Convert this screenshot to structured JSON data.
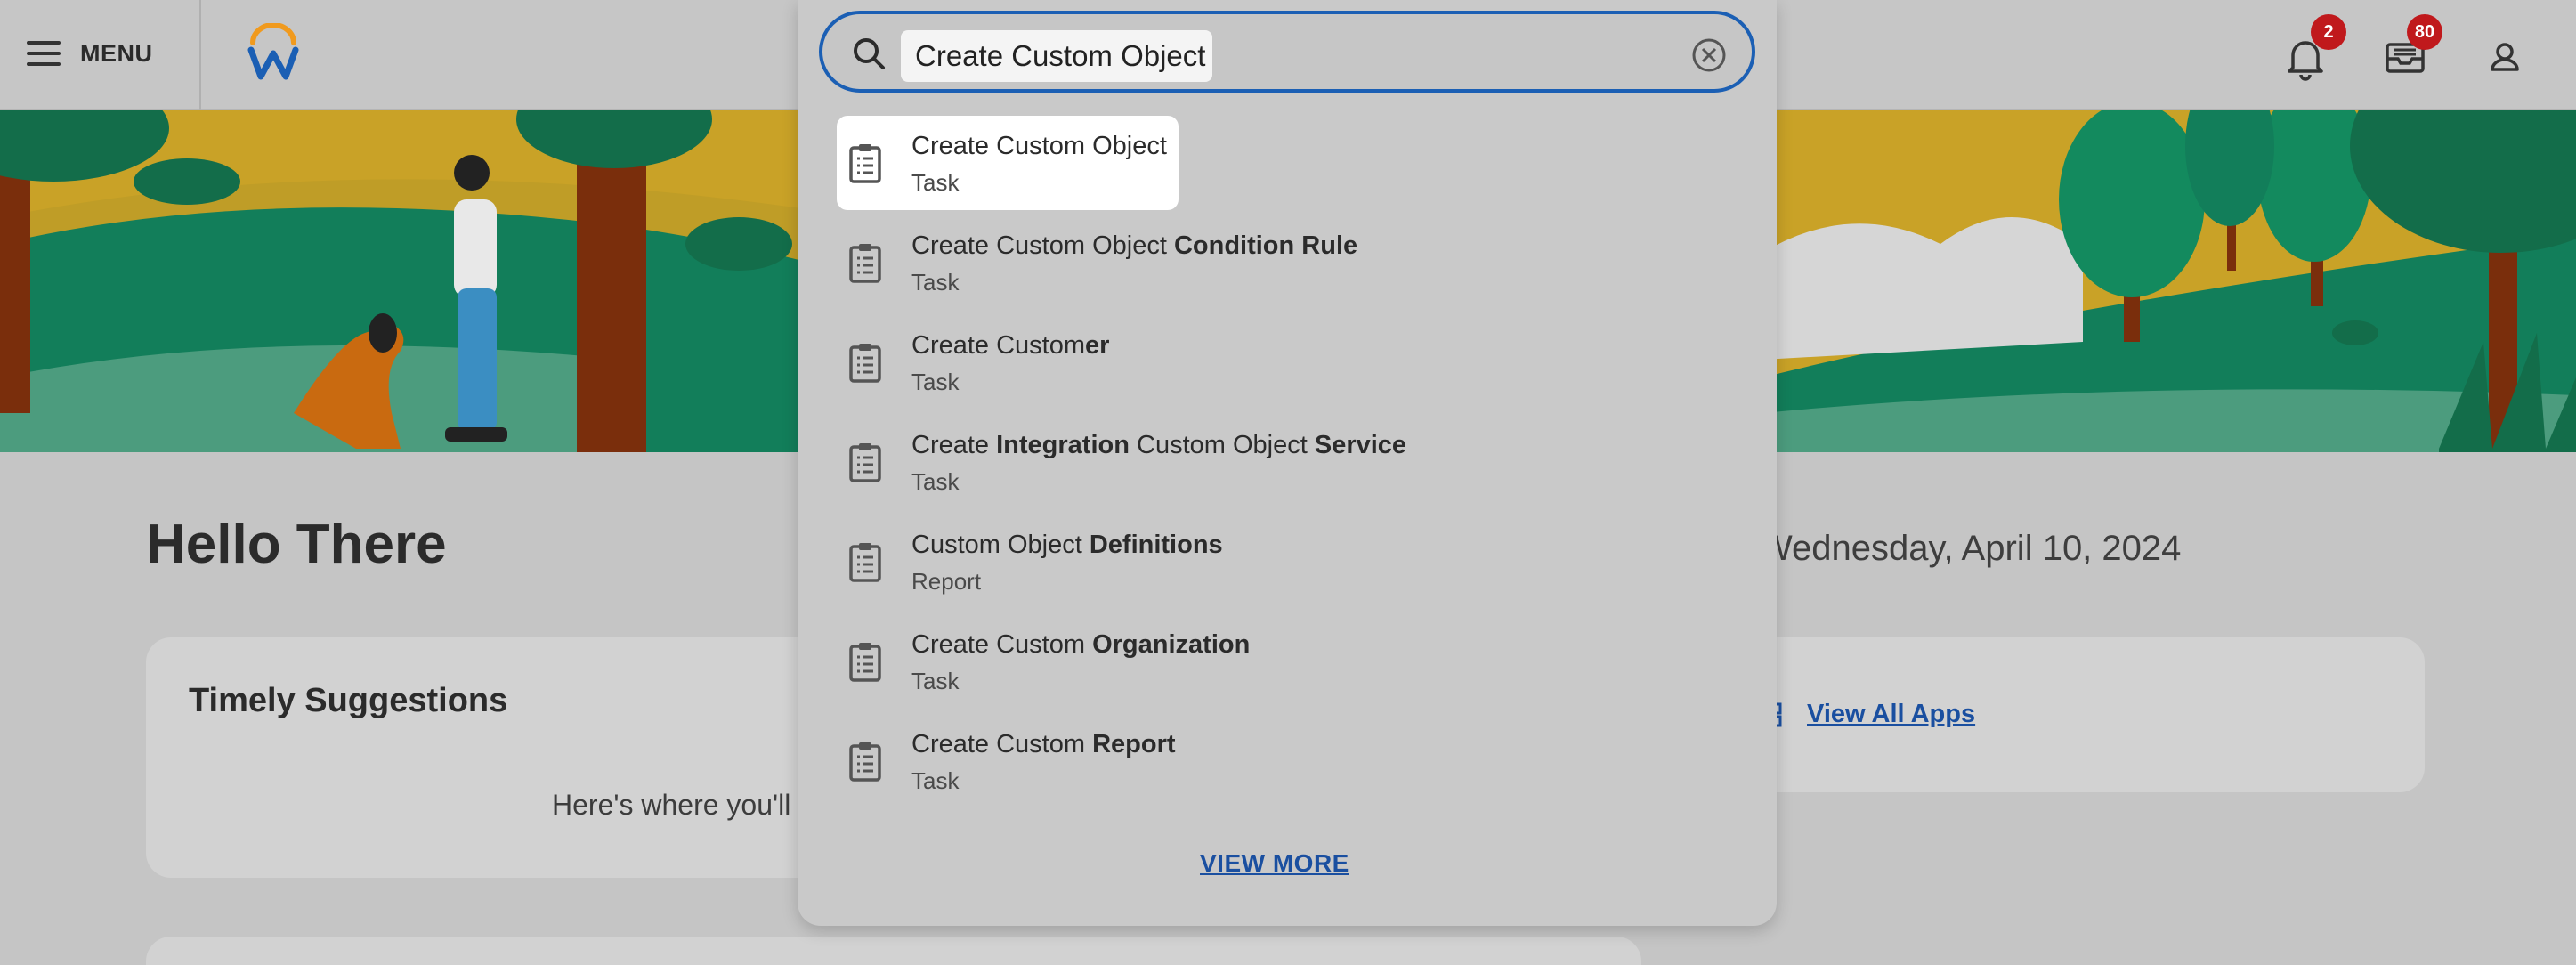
{
  "header": {
    "menu_label": "MENU",
    "notifications_count": "2",
    "inbox_count": "80"
  },
  "search": {
    "value": "Create Custom Object",
    "results": [
      {
        "parts": [
          {
            "t": "Create Custom Object",
            "b": false
          }
        ],
        "type": "Task"
      },
      {
        "parts": [
          {
            "t": "Create Custom Object ",
            "b": false
          },
          {
            "t": "Condition Rule",
            "b": true
          }
        ],
        "type": "Task"
      },
      {
        "parts": [
          {
            "t": "Create Custom",
            "b": false
          },
          {
            "t": "er",
            "b": true
          }
        ],
        "type": "Task"
      },
      {
        "parts": [
          {
            "t": "Create ",
            "b": false
          },
          {
            "t": "Integration",
            "b": true
          },
          {
            "t": " Custom Object ",
            "b": false
          },
          {
            "t": "Service",
            "b": true
          }
        ],
        "type": "Task"
      },
      {
        "parts": [
          {
            "t": "Custom Object ",
            "b": false
          },
          {
            "t": "Definitions",
            "b": true
          }
        ],
        "type": "Report"
      },
      {
        "parts": [
          {
            "t": "Create Custom ",
            "b": false
          },
          {
            "t": "Organization",
            "b": true
          }
        ],
        "type": "Task"
      },
      {
        "parts": [
          {
            "t": "Create Custom ",
            "b": false
          },
          {
            "t": "Report",
            "b": true
          }
        ],
        "type": "Task"
      }
    ],
    "view_more": "VIEW MORE"
  },
  "page": {
    "greeting": "Hello There",
    "date": "Wednesday, April 10, 2024",
    "suggestions_title": "Timely Suggestions",
    "suggestions_text": "Here's where you'll",
    "view_all_apps": "View All Apps"
  },
  "colors": {
    "accent": "#1b5fb4",
    "badge": "#c0191c",
    "link": "#1a4fa0"
  }
}
